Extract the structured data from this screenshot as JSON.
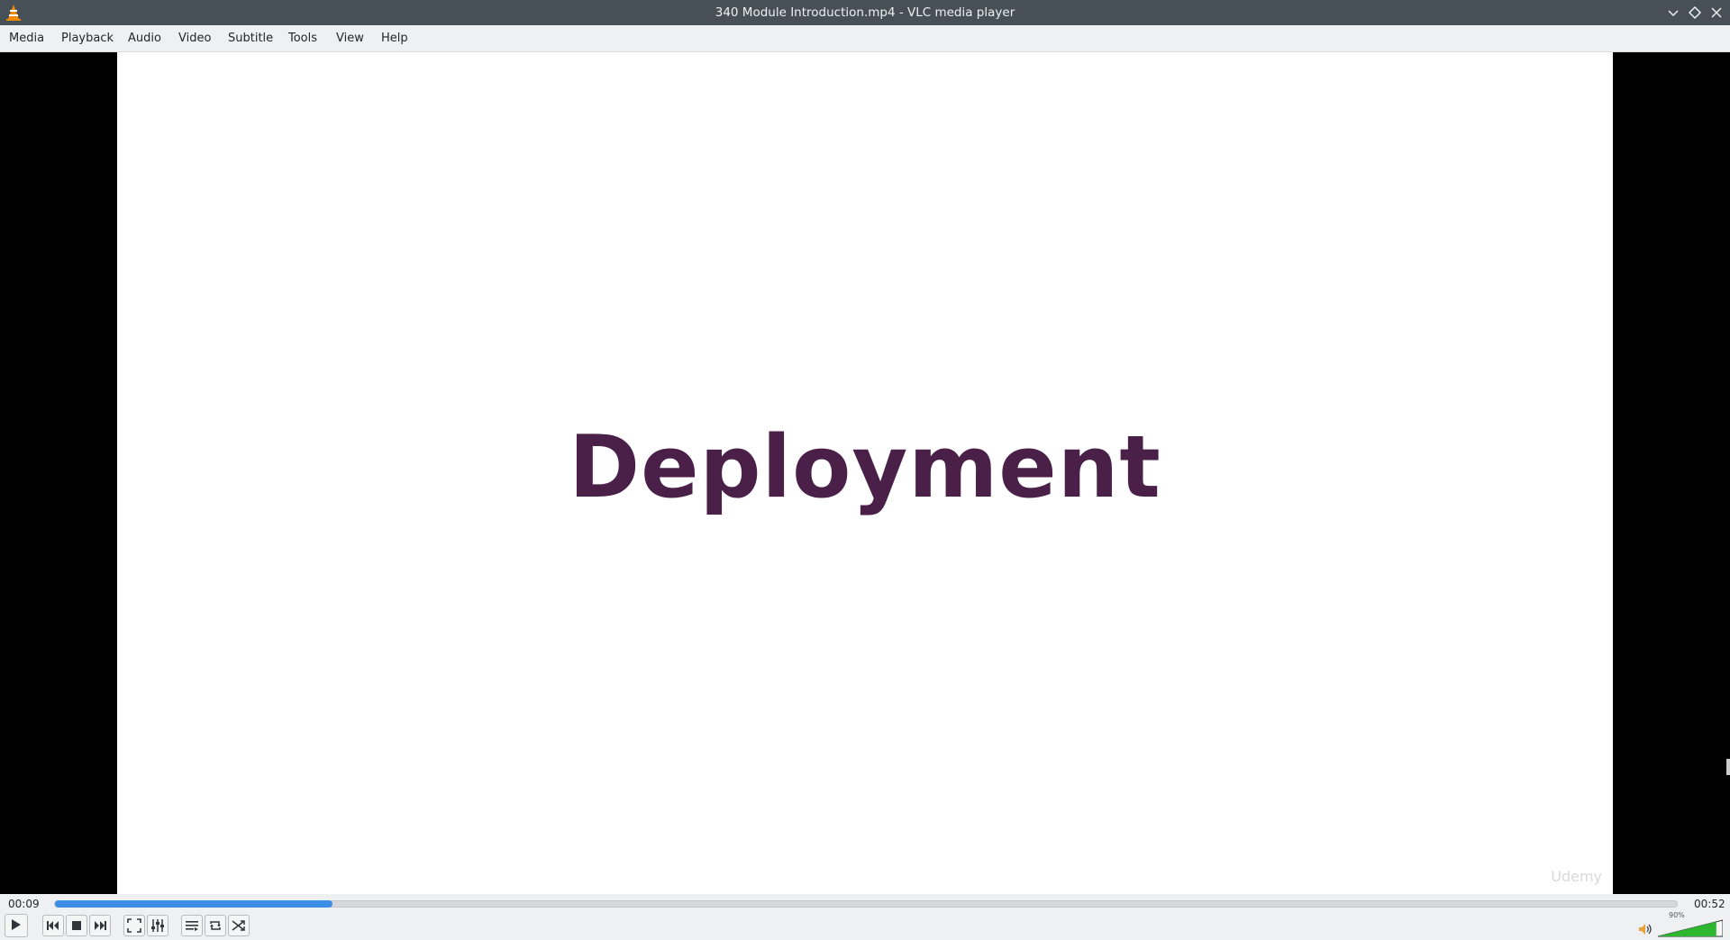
{
  "window": {
    "title": "340 Module Introduction.mp4 - VLC media player",
    "icons": [
      "vlc-cone-icon",
      "minimize-icon",
      "maximize-icon",
      "close-icon"
    ]
  },
  "menu": {
    "items": [
      "Media",
      "Playback",
      "Audio",
      "Video",
      "Subtitle",
      "Tools",
      "View",
      "Help"
    ]
  },
  "video": {
    "slide_title": "Deployment",
    "watermark": "Udemy"
  },
  "playback": {
    "elapsed": "00:09",
    "total": "00:52",
    "progress_fraction": 0.171,
    "volume_label": "90%",
    "volume_fraction": 0.9
  },
  "controls": {
    "icons": [
      "play-icon",
      "previous-icon",
      "stop-icon",
      "next-icon",
      "fullscreen-icon",
      "extended-settings-icon",
      "playlist-icon",
      "loop-icon",
      "shuffle-icon",
      "speaker-icon"
    ]
  },
  "colors": {
    "titlebar": "#475057",
    "slide_title": "#4a1f48",
    "progress": "#3a8ee6",
    "volume": "#2fb62f"
  }
}
